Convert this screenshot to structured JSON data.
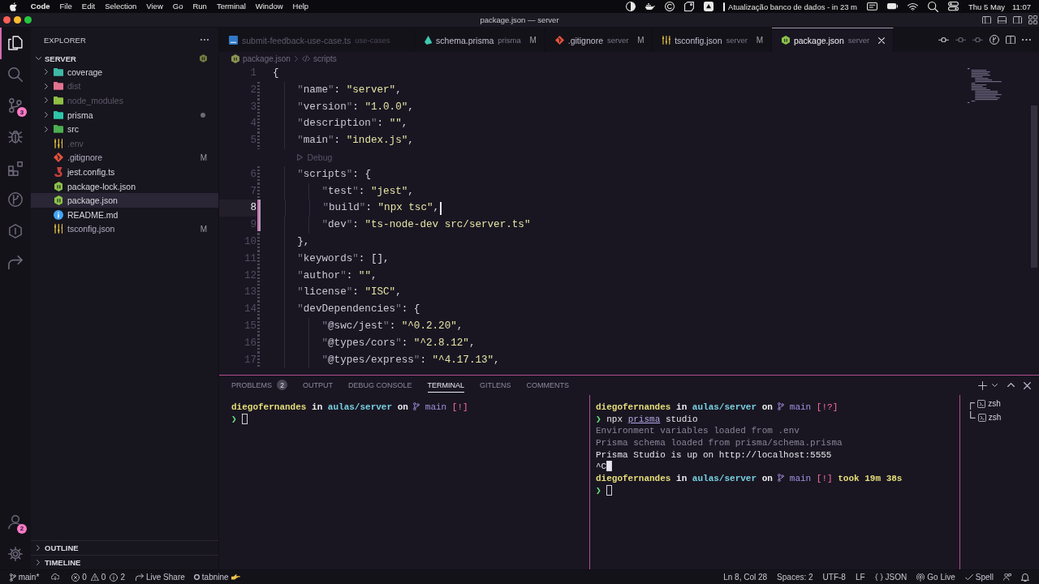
{
  "menu_bar": {
    "app": "Code",
    "menus": [
      "File",
      "Edit",
      "Selection",
      "View",
      "Go",
      "Run",
      "Terminal",
      "Window",
      "Help"
    ],
    "event": "Atualização banco de dados - in 23 m",
    "date": "Thu 5 May",
    "time": "11:07"
  },
  "window": {
    "title": "package.json — server"
  },
  "activity_bar": {
    "items": [
      {
        "kind": "files",
        "selected": true
      },
      {
        "kind": "search",
        "selected": false
      },
      {
        "kind": "source-control",
        "selected": false,
        "badge": "3"
      },
      {
        "kind": "debug",
        "selected": false
      },
      {
        "kind": "extensions",
        "selected": false
      },
      {
        "kind": "graph",
        "selected": false
      },
      {
        "kind": "hexagon",
        "selected": false
      },
      {
        "kind": "share",
        "selected": false
      }
    ],
    "bottom": [
      {
        "kind": "accounts",
        "badge": "2"
      },
      {
        "kind": "settings"
      }
    ]
  },
  "sidebar": {
    "title": "EXPLORER",
    "folder": {
      "title": "SERVER",
      "expanded": true,
      "items": [
        {
          "name": "coverage",
          "kind": "folder",
          "color": "#3fb8a5",
          "expanded": false,
          "ignored": false,
          "selected": false,
          "dot": false
        },
        {
          "name": "dist",
          "kind": "folder",
          "color": "#e2728f",
          "expanded": false,
          "ignored": true,
          "selected": false,
          "dot": false
        },
        {
          "name": "node_modules",
          "kind": "folder",
          "color": "#8fbf45",
          "expanded": false,
          "ignored": true,
          "selected": false,
          "dot": false
        },
        {
          "name": "prisma",
          "kind": "folder",
          "color": "#2fc6a8",
          "expanded": false,
          "ignored": false,
          "selected": false,
          "dot": true
        },
        {
          "name": "src",
          "kind": "folder",
          "color": "#4caf50",
          "expanded": false,
          "ignored": false,
          "selected": false,
          "dot": false
        },
        {
          "name": ".env",
          "kind": "settings",
          "color": "#e2c23d",
          "ignored": true,
          "selected": false,
          "dot": false
        },
        {
          "name": ".gitignore",
          "kind": "git",
          "color": "#e5533a",
          "badge": "M",
          "ignored": false,
          "selected": false,
          "dot": false
        },
        {
          "name": "jest.config.ts",
          "kind": "jest",
          "color": "#c8413f",
          "ignored": false,
          "selected": false,
          "dot": false
        },
        {
          "name": "package-lock.json",
          "kind": "node",
          "color": "#8bc34a",
          "ignored": false,
          "selected": false,
          "dot": false
        },
        {
          "name": "package.json",
          "kind": "node",
          "color": "#8bc34a",
          "ignored": false,
          "selected": true,
          "dot": false
        },
        {
          "name": "README.md",
          "kind": "info",
          "color": "#42a5f5",
          "ignored": false,
          "selected": false,
          "dot": false
        },
        {
          "name": "tsconfig.json",
          "kind": "settings",
          "color": "#e2c23d",
          "badge": "M",
          "ignored": false,
          "selected": false,
          "dot": false
        }
      ]
    },
    "sections": [
      {
        "title": "OUTLINE",
        "expanded": false
      },
      {
        "title": "TIMELINE",
        "expanded": false
      }
    ]
  },
  "tabs": [
    {
      "label": "submit-feedback-use-case.ts",
      "description": "use-cases",
      "kind": "typescript",
      "selected": false,
      "dimmed": true
    },
    {
      "label": "schema.prisma",
      "description": "prisma",
      "badge": "M",
      "kind": "prisma",
      "selected": false,
      "dimmed": false
    },
    {
      "label": ".gitignore",
      "description": "server",
      "badge": "M",
      "kind": "git",
      "selected": false,
      "dimmed": false
    },
    {
      "label": "tsconfig.json",
      "description": "server",
      "badge": "M",
      "kind": "settings",
      "selected": false,
      "dimmed": false
    },
    {
      "label": "package.json",
      "description": "server",
      "kind": "node",
      "selected": true,
      "dimmed": false
    }
  ],
  "breadcrumbs": [
    {
      "kind": "file",
      "label": "package.json"
    },
    {
      "kind": "symbol",
      "label": "scripts"
    }
  ],
  "editor": {
    "lines": [
      {
        "kind": "code",
        "number": "1",
        "text": "{",
        "active": false,
        "modified": false
      },
      {
        "kind": "code",
        "number": "2",
        "text": "    \"name\": \"server\",",
        "active": false,
        "modified": true
      },
      {
        "kind": "code",
        "number": "3",
        "text": "    \"version\": \"1.0.0\",",
        "active": false,
        "modified": true
      },
      {
        "kind": "code",
        "number": "4",
        "text": "    \"description\": \"\",",
        "active": false,
        "modified": true
      },
      {
        "kind": "code",
        "number": "5",
        "text": "    \"main\": \"index.js\",",
        "active": false,
        "modified": true
      },
      {
        "kind": "codelens",
        "text": "    Debug"
      },
      {
        "kind": "code",
        "number": "6",
        "text": "    \"scripts\": {",
        "active": false,
        "modified": true
      },
      {
        "kind": "code",
        "number": "7",
        "text": "        \"test\": \"jest\",",
        "active": false,
        "modified": true
      },
      {
        "kind": "code",
        "number": "8",
        "text": "        \"build\": \"npx tsc\",",
        "active": true,
        "modified": true
      },
      {
        "kind": "code",
        "number": "9",
        "text": "        \"dev\": \"ts-node-dev src/server.ts\"",
        "active": false,
        "modified": true
      },
      {
        "kind": "code",
        "number": "10",
        "text": "    },",
        "active": false,
        "modified": true
      },
      {
        "kind": "code",
        "number": "11",
        "text": "    \"keywords\": [],",
        "active": false,
        "modified": true
      },
      {
        "kind": "code",
        "number": "12",
        "text": "    \"author\": \"\",",
        "active": false,
        "modified": true
      },
      {
        "kind": "code",
        "number": "13",
        "text": "    \"license\": \"ISC\",",
        "active": false,
        "modified": true
      },
      {
        "kind": "code",
        "number": "14",
        "text": "    \"devDependencies\": {",
        "active": false,
        "modified": true
      },
      {
        "kind": "code",
        "number": "15",
        "text": "        \"@swc/jest\": \"^0.2.20\",",
        "active": false,
        "modified": true
      },
      {
        "kind": "code",
        "number": "16",
        "text": "        \"@types/cors\": \"^2.8.12\",",
        "active": false,
        "modified": true
      },
      {
        "kind": "code",
        "number": "17",
        "text": "        \"@types/express\": \"^4.17.13\",",
        "active": false,
        "modified": true
      }
    ]
  },
  "panel": {
    "tabs": [
      {
        "label": "PROBLEMS",
        "badge": "2",
        "selected": false
      },
      {
        "label": "OUTPUT",
        "selected": false
      },
      {
        "label": "DEBUG CONSOLE",
        "selected": false
      },
      {
        "label": "TERMINAL",
        "selected": true
      },
      {
        "label": "GITLENS",
        "selected": false
      },
      {
        "label": "COMMENTS",
        "selected": false
      }
    ],
    "terminals": [
      {
        "lines": [
          {
            "segments": [
              {
                "kind": "user",
                "text": "diegofernandes"
              },
              {
                "kind": "word",
                "text": "in"
              },
              {
                "kind": "path",
                "text": "aulas/server"
              },
              {
                "kind": "word",
                "text": "on"
              },
              {
                "kind": "branch",
                "text": "main"
              },
              {
                "kind": "status",
                "text": "[!]"
              }
            ]
          },
          {
            "segments": [
              {
                "kind": "arrow",
                "text": "❯"
              },
              {
                "kind": "cursor"
              }
            ]
          }
        ]
      },
      {
        "lines": [
          {
            "segments": [
              {
                "kind": "user",
                "text": "diegofernandes"
              },
              {
                "kind": "word",
                "text": "in"
              },
              {
                "kind": "path",
                "text": "aulas/server"
              },
              {
                "kind": "word",
                "text": "on"
              },
              {
                "kind": "branch",
                "text": "main"
              },
              {
                "kind": "status",
                "text": "[!?]"
              }
            ]
          },
          {
            "segments": [
              {
                "kind": "arrow",
                "text": "❯"
              },
              {
                "kind": "command",
                "text": "npx"
              },
              {
                "kind": "link",
                "text": "prisma"
              },
              {
                "kind": "plain",
                "text": "studio"
              }
            ]
          },
          {
            "segments": [
              {
                "kind": "dim",
                "text": "Environment variables loaded from .env"
              }
            ]
          },
          {
            "segments": [
              {
                "kind": "dim",
                "text": "Prisma schema loaded from prisma/schema.prisma"
              }
            ]
          },
          {
            "segments": [
              {
                "kind": "plain",
                "text": "Prisma Studio is up on http://localhost:5555"
              }
            ]
          },
          {
            "segments": [
              {
                "kind": "plain",
                "text": "^C"
              },
              {
                "kind": "block"
              }
            ]
          },
          {
            "segments": [
              {
                "kind": "user",
                "text": "diegofernandes"
              },
              {
                "kind": "word",
                "text": "in"
              },
              {
                "kind": "path",
                "text": "aulas/server"
              },
              {
                "kind": "word",
                "text": "on"
              },
              {
                "kind": "branch",
                "text": "main"
              },
              {
                "kind": "status",
                "text": "[!]"
              },
              {
                "kind": "duration",
                "text": "took 19m 38s"
              }
            ]
          },
          {
            "segments": [
              {
                "kind": "arrow",
                "text": "❯"
              },
              {
                "kind": "cursor"
              }
            ]
          }
        ]
      }
    ],
    "terminal_list": [
      {
        "label": "zsh"
      },
      {
        "label": "zsh"
      }
    ]
  },
  "status_bar": {
    "left": [
      {
        "kind": "branch",
        "text": "main*"
      },
      {
        "kind": "sync"
      },
      {
        "kind": "errors",
        "text": "0"
      },
      {
        "kind": "warnings",
        "text": "0"
      },
      {
        "kind": "info",
        "text": "2"
      },
      {
        "kind": "live-share",
        "text": "Live Share"
      },
      {
        "kind": "tabnine",
        "text": "tabnine"
      }
    ],
    "right": [
      {
        "kind": "text",
        "text": "Ln 8, Col 28"
      },
      {
        "kind": "text",
        "text": "Spaces: 2"
      },
      {
        "kind": "text",
        "text": "UTF-8"
      },
      {
        "kind": "text",
        "text": "LF"
      },
      {
        "kind": "language",
        "text": "JSON"
      },
      {
        "kind": "go-live",
        "text": "Go Live"
      },
      {
        "kind": "spell",
        "text": "Spell"
      },
      {
        "kind": "feedback"
      },
      {
        "kind": "bell"
      }
    ]
  }
}
